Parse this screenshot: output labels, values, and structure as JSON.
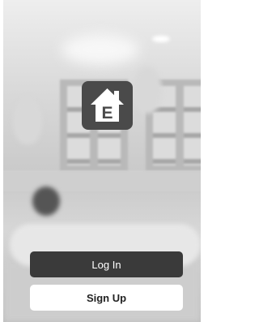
{
  "app": {
    "logo_icon": "house-e-logo-icon",
    "logo_letter": "E"
  },
  "auth": {
    "login_label": "Log In",
    "signup_label": "Sign Up"
  },
  "colors": {
    "login_bg": "#3a3a3a",
    "signup_bg": "#ffffff",
    "logo_bg": "#4a4a4a"
  }
}
